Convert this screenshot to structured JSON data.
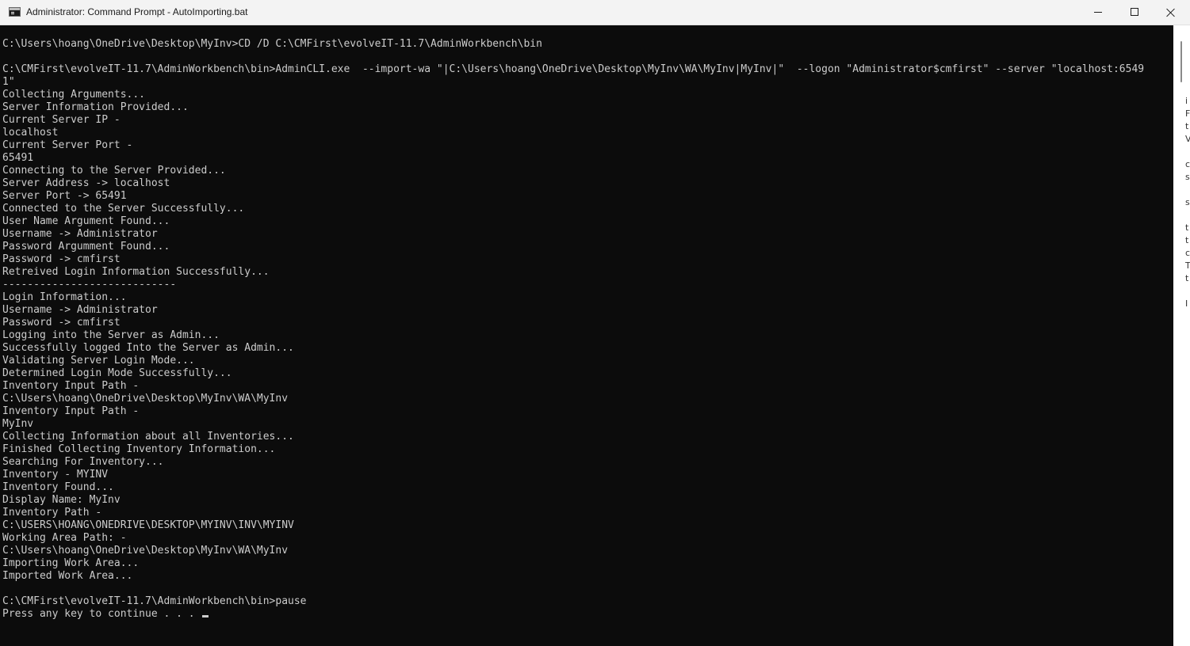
{
  "window": {
    "title": "Administrator: Command Prompt - AutoImporting.bat",
    "buttons": {
      "minimize_icon": "minimize-icon",
      "maximize_icon": "maximize-icon",
      "close_icon": "close-icon"
    }
  },
  "console": {
    "background": "#0c0c0c",
    "foreground": "#cccccc",
    "lines": [
      "C:\\Users\\hoang\\OneDrive\\Desktop\\MyInv>CD /D C:\\CMFirst\\evolveIT-11.7\\AdminWorkbench\\bin",
      "",
      "C:\\CMFirst\\evolveIT-11.7\\AdminWorkbench\\bin>AdminCLI.exe  --import-wa \"|C:\\Users\\hoang\\OneDrive\\Desktop\\MyInv\\WA\\MyInv|MyInv|\"  --logon \"Administrator$cmfirst\" --server \"localhost:6549",
      "1\"",
      "Collecting Arguments...",
      "Server Information Provided...",
      "Current Server IP -",
      "localhost",
      "Current Server Port -",
      "65491",
      "Connecting to the Server Provided...",
      "Server Address -> localhost",
      "Server Port -> 65491",
      "Connected to the Server Successfully...",
      "User Name Argument Found...",
      "Username -> Administrator",
      "Password Argumment Found...",
      "Password -> cmfirst",
      "Retreived Login Information Successfully...",
      "----------------------------",
      "Login Information...",
      "Username -> Administrator",
      "Password -> cmfirst",
      "Logging into the Server as Admin...",
      "Successfully logged Into the Server as Admin...",
      "Validating Server Login Mode...",
      "Determined Login Mode Successfully...",
      "Inventory Input Path -",
      "C:\\Users\\hoang\\OneDrive\\Desktop\\MyInv\\WA\\MyInv",
      "Inventory Input Path -",
      "MyInv",
      "Collecting Information about all Inventories...",
      "Finished Collecting Inventory Information...",
      "Searching For Inventory...",
      "Inventory - MYINV",
      "Inventory Found...",
      "Display Name: MyInv",
      "Inventory Path -",
      "C:\\USERS\\HOANG\\ONEDRIVE\\DESKTOP\\MYINV\\INV\\MYINV",
      "Working Area Path: -",
      "C:\\Users\\hoang\\OneDrive\\Desktop\\MyInv\\WA\\MyInv",
      "Importing Work Area...",
      "Imported Work Area...",
      "",
      "C:\\CMFirst\\evolveIT-11.7\\AdminWorkbench\\bin>pause",
      "Press any key to continue . . . "
    ]
  },
  "background_window_edge": [
    "i",
    "F",
    "t",
    "V",
    "",
    "c",
    "s",
    "",
    "s",
    "",
    "t",
    "t",
    "c",
    "T",
    "t",
    "",
    "I"
  ]
}
